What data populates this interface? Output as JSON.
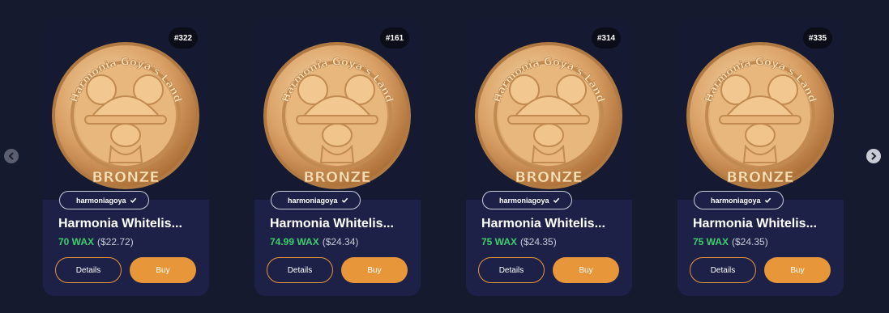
{
  "carousel": {
    "prev_icon": "chevron-left-icon",
    "next_icon": "chevron-right-icon"
  },
  "colors": {
    "background": "#161a2e",
    "card": "#1d2147",
    "accent": "#e8963a",
    "price_green": "#3fce6c",
    "coin_gold": "#d9a066"
  },
  "coin": {
    "ring_text": "Harmonia Goya's Land",
    "tier_text": "BRONZE"
  },
  "cards": [
    {
      "mint": "#322",
      "collection": "harmoniagoya",
      "title": "Harmonia Whitelis...",
      "price_wax": "70 WAX",
      "price_usd": "($22.72)",
      "details_label": "Details",
      "buy_label": "Buy"
    },
    {
      "mint": "#161",
      "collection": "harmoniagoya",
      "title": "Harmonia Whitelis...",
      "price_wax": "74.99 WAX",
      "price_usd": "($24.34)",
      "details_label": "Details",
      "buy_label": "Buy"
    },
    {
      "mint": "#314",
      "collection": "harmoniagoya",
      "title": "Harmonia Whitelis...",
      "price_wax": "75 WAX",
      "price_usd": "($24.35)",
      "details_label": "Details",
      "buy_label": "Buy"
    },
    {
      "mint": "#335",
      "collection": "harmoniagoya",
      "title": "Harmonia Whitelis...",
      "price_wax": "75 WAX",
      "price_usd": "($24.35)",
      "details_label": "Details",
      "buy_label": "Buy"
    }
  ]
}
